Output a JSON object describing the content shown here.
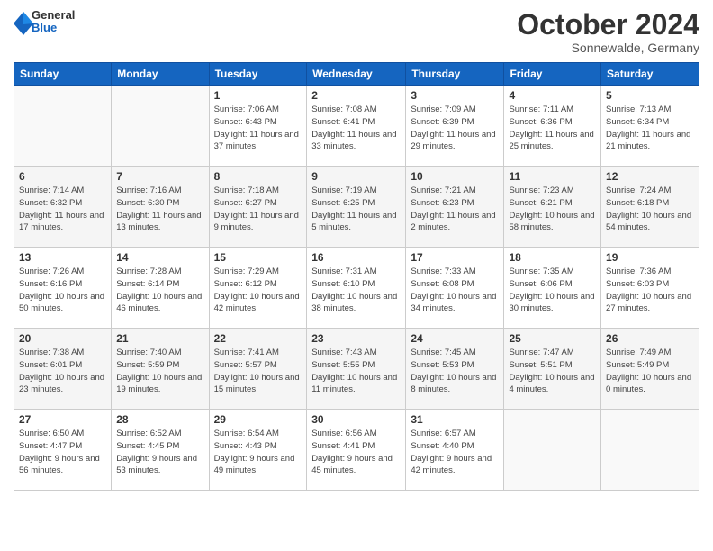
{
  "header": {
    "logo": {
      "general": "General",
      "blue": "Blue"
    },
    "title": "October 2024",
    "subtitle": "Sonnewalde, Germany"
  },
  "weekdays": [
    "Sunday",
    "Monday",
    "Tuesday",
    "Wednesday",
    "Thursday",
    "Friday",
    "Saturday"
  ],
  "weeks": [
    [
      {
        "day": "",
        "info": ""
      },
      {
        "day": "",
        "info": ""
      },
      {
        "day": "1",
        "info": "Sunrise: 7:06 AM\nSunset: 6:43 PM\nDaylight: 11 hours and 37 minutes."
      },
      {
        "day": "2",
        "info": "Sunrise: 7:08 AM\nSunset: 6:41 PM\nDaylight: 11 hours and 33 minutes."
      },
      {
        "day": "3",
        "info": "Sunrise: 7:09 AM\nSunset: 6:39 PM\nDaylight: 11 hours and 29 minutes."
      },
      {
        "day": "4",
        "info": "Sunrise: 7:11 AM\nSunset: 6:36 PM\nDaylight: 11 hours and 25 minutes."
      },
      {
        "day": "5",
        "info": "Sunrise: 7:13 AM\nSunset: 6:34 PM\nDaylight: 11 hours and 21 minutes."
      }
    ],
    [
      {
        "day": "6",
        "info": "Sunrise: 7:14 AM\nSunset: 6:32 PM\nDaylight: 11 hours and 17 minutes."
      },
      {
        "day": "7",
        "info": "Sunrise: 7:16 AM\nSunset: 6:30 PM\nDaylight: 11 hours and 13 minutes."
      },
      {
        "day": "8",
        "info": "Sunrise: 7:18 AM\nSunset: 6:27 PM\nDaylight: 11 hours and 9 minutes."
      },
      {
        "day": "9",
        "info": "Sunrise: 7:19 AM\nSunset: 6:25 PM\nDaylight: 11 hours and 5 minutes."
      },
      {
        "day": "10",
        "info": "Sunrise: 7:21 AM\nSunset: 6:23 PM\nDaylight: 11 hours and 2 minutes."
      },
      {
        "day": "11",
        "info": "Sunrise: 7:23 AM\nSunset: 6:21 PM\nDaylight: 10 hours and 58 minutes."
      },
      {
        "day": "12",
        "info": "Sunrise: 7:24 AM\nSunset: 6:18 PM\nDaylight: 10 hours and 54 minutes."
      }
    ],
    [
      {
        "day": "13",
        "info": "Sunrise: 7:26 AM\nSunset: 6:16 PM\nDaylight: 10 hours and 50 minutes."
      },
      {
        "day": "14",
        "info": "Sunrise: 7:28 AM\nSunset: 6:14 PM\nDaylight: 10 hours and 46 minutes."
      },
      {
        "day": "15",
        "info": "Sunrise: 7:29 AM\nSunset: 6:12 PM\nDaylight: 10 hours and 42 minutes."
      },
      {
        "day": "16",
        "info": "Sunrise: 7:31 AM\nSunset: 6:10 PM\nDaylight: 10 hours and 38 minutes."
      },
      {
        "day": "17",
        "info": "Sunrise: 7:33 AM\nSunset: 6:08 PM\nDaylight: 10 hours and 34 minutes."
      },
      {
        "day": "18",
        "info": "Sunrise: 7:35 AM\nSunset: 6:06 PM\nDaylight: 10 hours and 30 minutes."
      },
      {
        "day": "19",
        "info": "Sunrise: 7:36 AM\nSunset: 6:03 PM\nDaylight: 10 hours and 27 minutes."
      }
    ],
    [
      {
        "day": "20",
        "info": "Sunrise: 7:38 AM\nSunset: 6:01 PM\nDaylight: 10 hours and 23 minutes."
      },
      {
        "day": "21",
        "info": "Sunrise: 7:40 AM\nSunset: 5:59 PM\nDaylight: 10 hours and 19 minutes."
      },
      {
        "day": "22",
        "info": "Sunrise: 7:41 AM\nSunset: 5:57 PM\nDaylight: 10 hours and 15 minutes."
      },
      {
        "day": "23",
        "info": "Sunrise: 7:43 AM\nSunset: 5:55 PM\nDaylight: 10 hours and 11 minutes."
      },
      {
        "day": "24",
        "info": "Sunrise: 7:45 AM\nSunset: 5:53 PM\nDaylight: 10 hours and 8 minutes."
      },
      {
        "day": "25",
        "info": "Sunrise: 7:47 AM\nSunset: 5:51 PM\nDaylight: 10 hours and 4 minutes."
      },
      {
        "day": "26",
        "info": "Sunrise: 7:49 AM\nSunset: 5:49 PM\nDaylight: 10 hours and 0 minutes."
      }
    ],
    [
      {
        "day": "27",
        "info": "Sunrise: 6:50 AM\nSunset: 4:47 PM\nDaylight: 9 hours and 56 minutes."
      },
      {
        "day": "28",
        "info": "Sunrise: 6:52 AM\nSunset: 4:45 PM\nDaylight: 9 hours and 53 minutes."
      },
      {
        "day": "29",
        "info": "Sunrise: 6:54 AM\nSunset: 4:43 PM\nDaylight: 9 hours and 49 minutes."
      },
      {
        "day": "30",
        "info": "Sunrise: 6:56 AM\nSunset: 4:41 PM\nDaylight: 9 hours and 45 minutes."
      },
      {
        "day": "31",
        "info": "Sunrise: 6:57 AM\nSunset: 4:40 PM\nDaylight: 9 hours and 42 minutes."
      },
      {
        "day": "",
        "info": ""
      },
      {
        "day": "",
        "info": ""
      }
    ]
  ]
}
